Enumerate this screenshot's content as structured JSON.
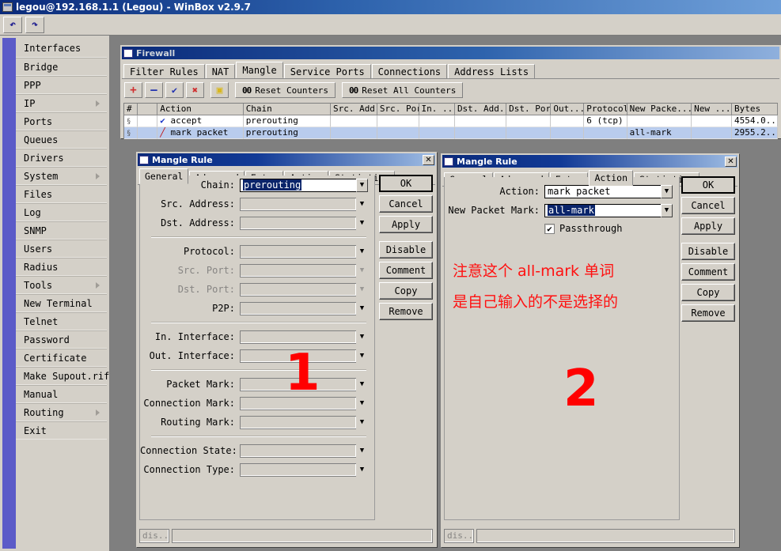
{
  "window": {
    "title": "legou@192.168.1.1 (Legou) - WinBox v2.9.7",
    "toolbar": {
      "undo": "↶",
      "redo": "↷"
    }
  },
  "sidebar": {
    "items": [
      {
        "label": "Interfaces",
        "submenu": false
      },
      {
        "label": "Bridge",
        "submenu": false
      },
      {
        "label": "PPP",
        "submenu": false
      },
      {
        "label": "IP",
        "submenu": true
      },
      {
        "label": "Ports",
        "submenu": false
      },
      {
        "label": "Queues",
        "submenu": false
      },
      {
        "label": "Drivers",
        "submenu": false
      },
      {
        "label": "System",
        "submenu": true
      },
      {
        "label": "Files",
        "submenu": false
      },
      {
        "label": "Log",
        "submenu": false
      },
      {
        "label": "SNMP",
        "submenu": false
      },
      {
        "label": "Users",
        "submenu": false
      },
      {
        "label": "Radius",
        "submenu": false
      },
      {
        "label": "Tools",
        "submenu": true
      },
      {
        "label": "New Terminal",
        "submenu": false
      },
      {
        "label": "Telnet",
        "submenu": false
      },
      {
        "label": "Password",
        "submenu": false
      },
      {
        "label": "Certificate",
        "submenu": false
      },
      {
        "label": "Make Supout.rif",
        "submenu": false
      },
      {
        "label": "Manual",
        "submenu": false
      },
      {
        "label": "Routing",
        "submenu": true
      },
      {
        "label": "Exit",
        "submenu": false
      }
    ]
  },
  "firewall": {
    "title": "Firewall",
    "tabs": [
      {
        "label": "Filter Rules",
        "active": false
      },
      {
        "label": "NAT",
        "active": false
      },
      {
        "label": "Mangle",
        "active": true
      },
      {
        "label": "Service Ports",
        "active": false
      },
      {
        "label": "Connections",
        "active": false
      },
      {
        "label": "Address Lists",
        "active": false
      }
    ],
    "toolbar": {
      "add": "+",
      "remove": "–",
      "enable": "✔",
      "disable": "✖",
      "comment": "▣",
      "reset_counters": "Reset Counters",
      "reset_all_counters": "Reset All Counters",
      "counter_prefix": "00"
    },
    "table": {
      "columns": [
        "#",
        "",
        "Action",
        "Chain",
        "Src. Add...",
        "Src. Port",
        "In. ...",
        "Dst. Add...",
        "Dst. Port",
        "Out....",
        "Protocol",
        "New Packe...",
        "New ...",
        "Bytes"
      ],
      "rows": [
        {
          "num": "",
          "flag": "",
          "icon": "check-icon",
          "action": "accept",
          "chain": "prerouting",
          "src_address": "",
          "src_port": "",
          "in_interface": "",
          "dst_address": "",
          "dst_port": "",
          "out_interface": "",
          "protocol": "6 (tcp)",
          "new_packet_mark": "",
          "new_other": "",
          "bytes": "4554.0..",
          "selected": false
        },
        {
          "num": "",
          "flag": "",
          "icon": "mark-pen-icon",
          "action": "mark packet",
          "chain": "prerouting",
          "src_address": "",
          "src_port": "",
          "in_interface": "",
          "dst_address": "",
          "dst_port": "",
          "out_interface": "",
          "protocol": "",
          "new_packet_mark": "all-mark",
          "new_other": "",
          "bytes": "2955.2..",
          "selected": true
        }
      ]
    }
  },
  "dialog1": {
    "title": "Mangle Rule",
    "close": "✕",
    "tabs": [
      {
        "label": "General",
        "active": true
      },
      {
        "label": "Advanced",
        "active": false
      },
      {
        "label": "Extra",
        "active": false
      },
      {
        "label": "Action",
        "active": false
      },
      {
        "label": "Statistics",
        "active": false
      }
    ],
    "fields": [
      {
        "label": "Chain:",
        "value": "prerouting",
        "focused": true,
        "dim": false,
        "group": 0
      },
      {
        "label": "Src. Address:",
        "value": "",
        "focused": false,
        "dim": false,
        "group": 0
      },
      {
        "label": "Dst. Address:",
        "value": "",
        "focused": false,
        "dim": false,
        "group": 0
      },
      {
        "label": "Protocol:",
        "value": "",
        "focused": false,
        "dim": false,
        "group": 1
      },
      {
        "label": "Src. Port:",
        "value": "",
        "focused": false,
        "dim": true,
        "group": 1
      },
      {
        "label": "Dst. Port:",
        "value": "",
        "focused": false,
        "dim": true,
        "group": 1
      },
      {
        "label": "P2P:",
        "value": "",
        "focused": false,
        "dim": false,
        "group": 1
      },
      {
        "label": "In. Interface:",
        "value": "",
        "focused": false,
        "dim": false,
        "group": 2
      },
      {
        "label": "Out. Interface:",
        "value": "",
        "focused": false,
        "dim": false,
        "group": 2
      },
      {
        "label": "Packet Mark:",
        "value": "",
        "focused": false,
        "dim": false,
        "group": 3
      },
      {
        "label": "Connection Mark:",
        "value": "",
        "focused": false,
        "dim": false,
        "group": 3
      },
      {
        "label": "Routing Mark:",
        "value": "",
        "focused": false,
        "dim": false,
        "group": 3
      },
      {
        "label": "Connection State:",
        "value": "",
        "focused": false,
        "dim": false,
        "group": 4
      },
      {
        "label": "Connection Type:",
        "value": "",
        "focused": false,
        "dim": false,
        "group": 4
      }
    ],
    "buttons": [
      "OK",
      "Cancel",
      "Apply",
      "Disable",
      "Comment",
      "Copy",
      "Remove"
    ],
    "status": "dis...",
    "marker": "1"
  },
  "dialog2": {
    "title": "Mangle Rule",
    "close": "✕",
    "tabs": [
      {
        "label": "General",
        "active": false
      },
      {
        "label": "Advanced",
        "active": false
      },
      {
        "label": "Extra",
        "active": false
      },
      {
        "label": "Action",
        "active": true
      },
      {
        "label": "Statistics",
        "active": false
      }
    ],
    "fields": [
      {
        "label": "Action:",
        "value": "mark packet",
        "focused": false,
        "boxed": true
      },
      {
        "label": "New Packet Mark:",
        "value": "all-mark",
        "focused": true,
        "boxed": true
      }
    ],
    "checkbox": {
      "label": "Passthrough",
      "checked": true,
      "mark": "✔"
    },
    "annotation_line1": "注意这个 all-mark 单词",
    "annotation_line2": "是自己输入的不是选择的",
    "buttons": [
      "OK",
      "Cancel",
      "Apply",
      "Disable",
      "Comment",
      "Copy",
      "Remove"
    ],
    "status": "dis...",
    "marker": "2"
  },
  "colors": {
    "titlebar_blue": "#0a2a7a",
    "face": "#d4d0c8",
    "selection_blue": "#0a246a",
    "row_select": "#b9cced",
    "annotation_red": "#ff1010",
    "desktop_gray": "#7f7f7f",
    "sidebar_strip": "#5b5bc8"
  }
}
